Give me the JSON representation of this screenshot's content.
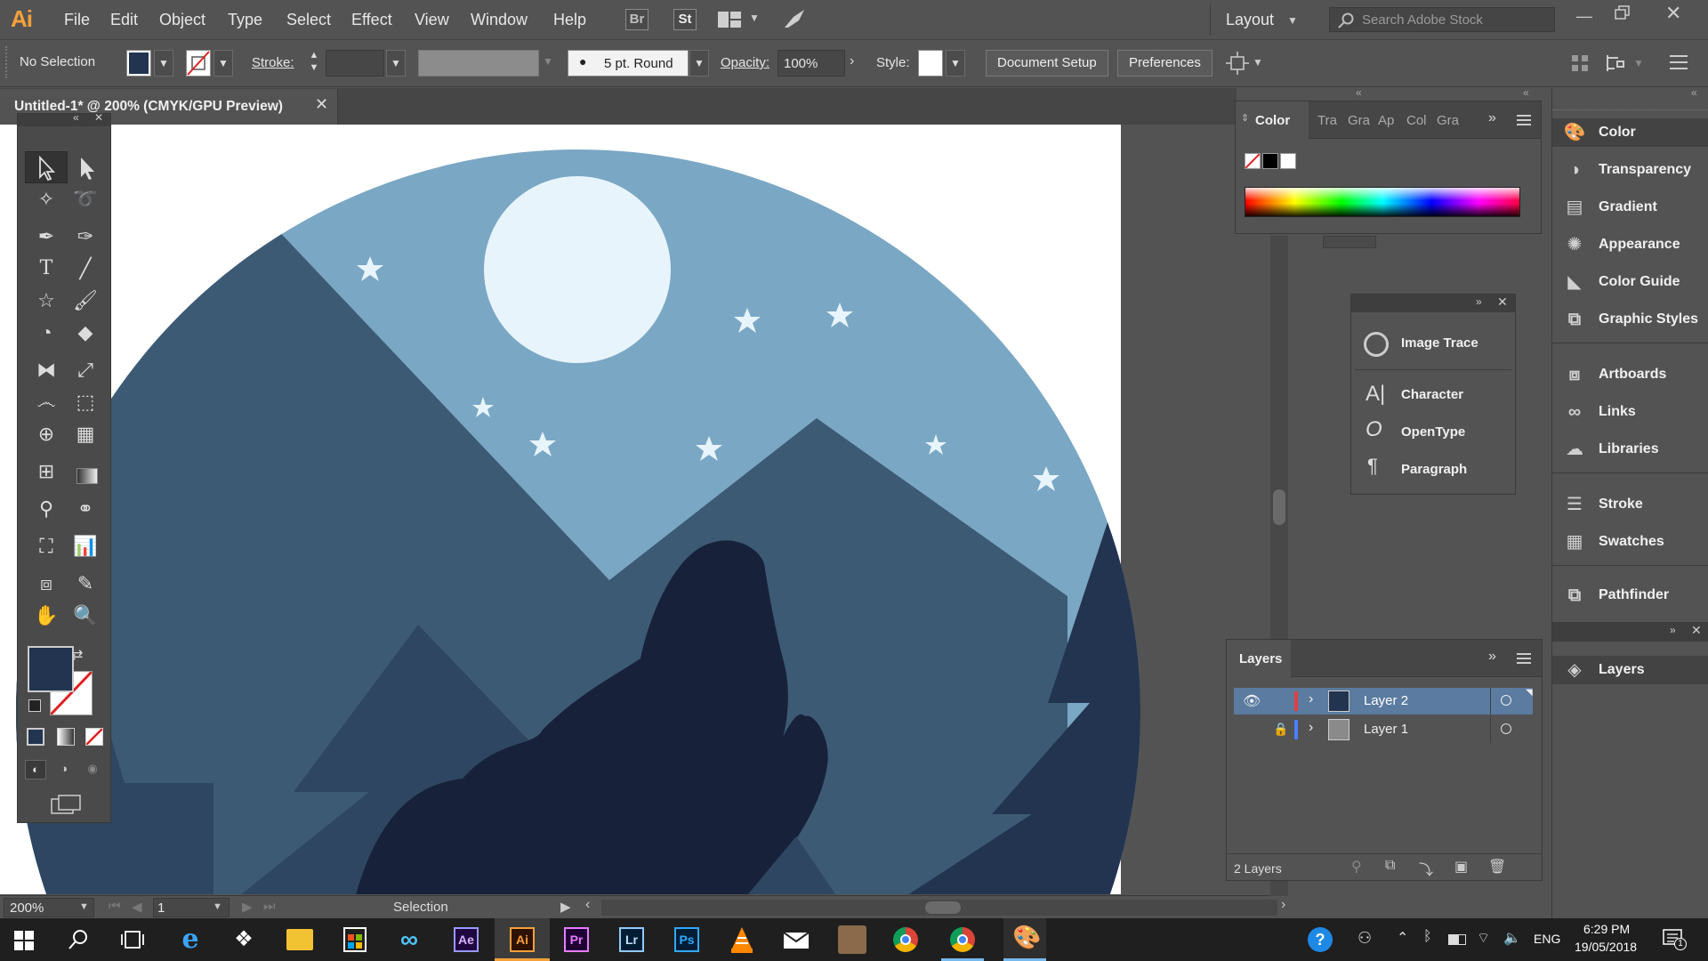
{
  "app": {
    "logo": "Ai",
    "menu": [
      "File",
      "Edit",
      "Object",
      "Type",
      "Select",
      "Effect",
      "View",
      "Window",
      "Help"
    ],
    "bridge_icon": "Br",
    "stock_icon": "St",
    "workspace": "Layout",
    "search_placeholder": "Search Adobe Stock"
  },
  "control": {
    "selection": "No Selection",
    "stroke_label": "Stroke:",
    "brush": "5 pt. Round",
    "opacity_label": "Opacity:",
    "opacity_value": "100%",
    "style_label": "Style:",
    "document_setup": "Document Setup",
    "preferences": "Preferences"
  },
  "document": {
    "tab_title": "Untitled-1* @ 200% (CMYK/GPU Preview)",
    "zoom": "200%",
    "artboard": "1",
    "status": "Selection"
  },
  "color_panel": {
    "tabs": [
      "Color",
      "Tra",
      "Gra",
      "Ap",
      "Col",
      "Gra"
    ]
  },
  "float_panel": {
    "items": [
      "Image Trace",
      "Character",
      "OpenType",
      "Paragraph"
    ]
  },
  "layers_panel": {
    "title": "Layers",
    "layers": [
      "Layer 2",
      "Layer 1"
    ],
    "count": "2 Layers"
  },
  "dock": {
    "group1": [
      "Color",
      "Transparency",
      "Gradient",
      "Appearance",
      "Color Guide",
      "Graphic Styles"
    ],
    "group2": [
      "Artboards",
      "Links",
      "Libraries"
    ],
    "group3": [
      "Stroke",
      "Swatches"
    ],
    "group4": [
      "Pathfinder"
    ],
    "group5": [
      "Layers"
    ]
  },
  "taskbar": {
    "language": "ENG",
    "time": "6:29 PM",
    "date": "19/05/2018",
    "notifications": "1",
    "apps": [
      "Ae",
      "Ai",
      "Pr",
      "Lr",
      "Ps"
    ]
  },
  "colors": {
    "ui_bg": "#535353",
    "ai_orange": "#f6a03a",
    "sky": "#7aa7c4",
    "moon": "#e8f4fc",
    "mountain_mid": "#3d5a75",
    "mountain_dark": "#223450",
    "wolf": "#17223a"
  }
}
